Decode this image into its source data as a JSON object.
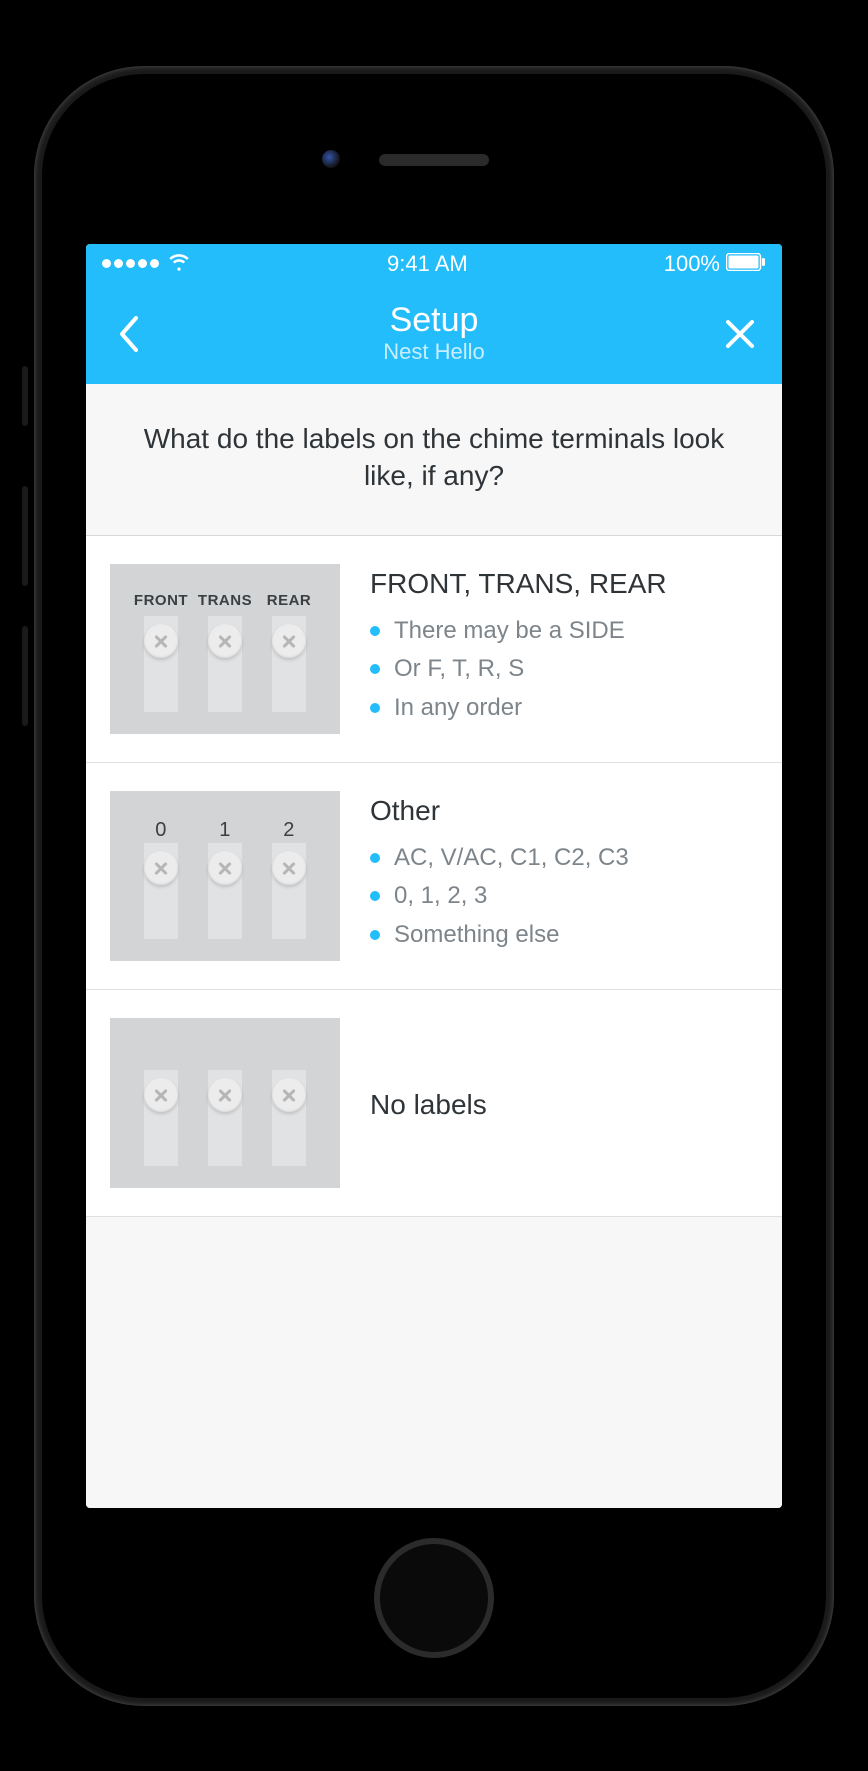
{
  "statusbar": {
    "time": "9:41 AM",
    "battery_label": "100%"
  },
  "nav": {
    "title": "Setup",
    "subtitle": "Nest Hello"
  },
  "question": "What do the labels on the chime terminals look like, if any?",
  "options": [
    {
      "title": "FRONT, TRANS, REAR",
      "diagram_labels": [
        "FRONT",
        "TRANS",
        "REAR"
      ],
      "label_style": "text",
      "bullets": [
        "There may be a SIDE",
        "Or F, T, R, S",
        "In any order"
      ]
    },
    {
      "title": "Other",
      "diagram_labels": [
        "0",
        "1",
        "2"
      ],
      "label_style": "num",
      "bullets": [
        "AC, V/AC, C1, C2, C3",
        "0, 1, 2, 3",
        "Something else"
      ]
    },
    {
      "title": "No labels",
      "diagram_labels": [
        "",
        "",
        ""
      ],
      "label_style": "none",
      "bullets": []
    }
  ],
  "colors": {
    "accent": "#22bdfa"
  }
}
